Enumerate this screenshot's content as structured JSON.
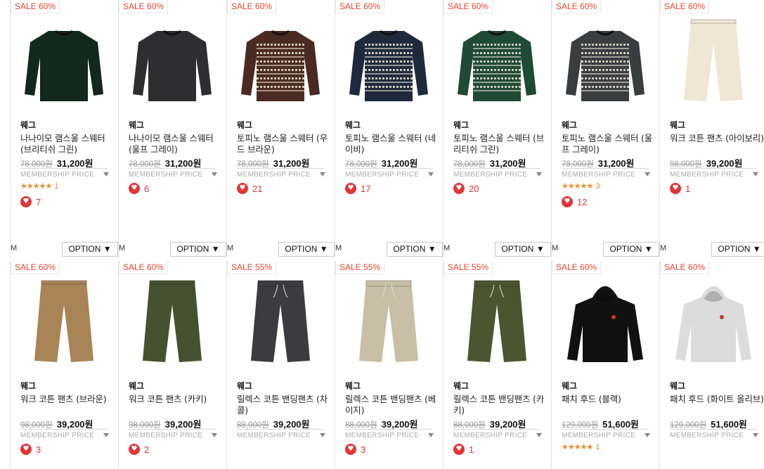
{
  "row1": [
    {
      "badge": "SALE 60%",
      "brand": "웨그",
      "name": "나나이모 램스울 스웨터 (브리티쉬 그린)",
      "orig_price": "78,000원",
      "sale_price": "31,200원",
      "membership": "MEMBERSHIP PRICE",
      "stars": "★★★★★",
      "rating_count": "1",
      "likes": "7",
      "size": "M",
      "option": "OPTION ▼",
      "image": "sweater-dark-green-icon",
      "color": "#12281c"
    },
    {
      "badge": "SALE 60%",
      "brand": "웨그",
      "name": "나나이모 램스울 스웨터 (울프 그레이)",
      "orig_price": "78,000원",
      "sale_price": "31,200원",
      "membership": "MEMBERSHIP PRICE",
      "likes": "6",
      "size": "M",
      "option": "OPTION ▼",
      "image": "sweater-charcoal-icon",
      "color": "#2e2e30"
    },
    {
      "badge": "SALE 60%",
      "brand": "웨그",
      "name": "토피노 램스울 스웨터 (우드 브라운)",
      "orig_price": "78,000원",
      "sale_price": "31,200원",
      "membership": "MEMBERSHIP PRICE",
      "likes": "21",
      "size": "M",
      "option": "OPTION ▼",
      "image": "fairisle-sweater-brown-icon",
      "color": "#4a2a22"
    },
    {
      "badge": "SALE 60%",
      "brand": "웨그",
      "name": "토피노 램스울 스웨터 (네이비)",
      "orig_price": "78,000원",
      "sale_price": "31,200원",
      "membership": "MEMBERSHIP PRICE",
      "likes": "17",
      "size": "M",
      "option": "OPTION ▼",
      "image": "fairisle-sweater-navy-icon",
      "color": "#1e2a3c"
    },
    {
      "badge": "SALE 60%",
      "brand": "웨그",
      "name": "토피노 램스울 스웨터 (브리티쉬 그린)",
      "orig_price": "78,000원",
      "sale_price": "31,200원",
      "membership": "MEMBERSHIP PRICE",
      "likes": "20",
      "size": "M",
      "option": "OPTION ▼",
      "image": "fairisle-sweater-green-icon",
      "color": "#1f4a35"
    },
    {
      "badge": "SALE 60%",
      "brand": "웨그",
      "name": "토피노 램스울 스웨터 (울프 그레이)",
      "orig_price": "78,000원",
      "sale_price": "31,200원",
      "membership": "MEMBERSHIP PRICE",
      "stars": "★★★★★",
      "rating_count": "3",
      "likes": "12",
      "size": "M",
      "option": "OPTION ▼",
      "image": "fairisle-sweater-grey-icon",
      "color": "#3a3d40"
    },
    {
      "badge": "SALE 60%",
      "brand": "웨그",
      "name": "워크 코튼 팬츠 (아이보리)",
      "orig_price": "98,000원",
      "sale_price": "39,200원",
      "membership": "MEMBERSHIP PRICE",
      "likes": "1",
      "size": "M",
      "option": "OPTION ▼",
      "image": "pants-ivory-icon",
      "color": "#efe6d4"
    }
  ],
  "row2": [
    {
      "badge": "SALE 60%",
      "brand": "웨그",
      "name": "워크 코튼 팬츠 (브라운)",
      "orig_price": "98,000원",
      "sale_price": "39,200원",
      "membership": "MEMBERSHIP PRICE",
      "likes": "3",
      "image": "pants-brown-icon",
      "color": "#a98457"
    },
    {
      "badge": "SALE 60%",
      "brand": "웨그",
      "name": "워크 코튼 팬츠 (카키)",
      "orig_price": "98,000원",
      "sale_price": "39,200원",
      "membership": "MEMBERSHIP PRICE",
      "likes": "2",
      "image": "pants-khaki-icon",
      "color": "#46512f"
    },
    {
      "badge": "SALE 55%",
      "brand": "웨그",
      "name": "릴렉스 코튼 밴딩팬츠 (차콜)",
      "orig_price": "88,000원",
      "sale_price": "39,200원",
      "membership": "MEMBERSHIP PRICE",
      "image": "banding-pants-charcoal-icon",
      "color": "#3c3c3e"
    },
    {
      "badge": "SALE 55%",
      "brand": "웨그",
      "name": "릴렉스 코튼 밴딩팬츠 (베이지)",
      "orig_price": "88,000원",
      "sale_price": "39,200원",
      "membership": "MEMBERSHIP PRICE",
      "likes": "3",
      "image": "banding-pants-beige-icon",
      "color": "#c9bfa6"
    },
    {
      "badge": "SALE 55%",
      "brand": "웨그",
      "name": "릴렉스 코튼 밴딩팬츠 (카키)",
      "orig_price": "88,000원",
      "sale_price": "39,200원",
      "membership": "MEMBERSHIP PRICE",
      "likes": "1",
      "image": "banding-pants-khaki-icon",
      "color": "#4b5530"
    },
    {
      "badge": "SALE 60%",
      "brand": "웨그",
      "name": "패치 후드 (블랙)",
      "orig_price": "129,000원",
      "sale_price": "51,600원",
      "membership": "MEMBERSHIP PRICE",
      "stars": "★★★★★",
      "rating_count": "1",
      "image": "hoodie-black-icon",
      "color": "#111111"
    },
    {
      "badge": "SALE 60%",
      "brand": "웨그",
      "name": "패치 후드 (화이트 올리브)",
      "orig_price": "129,000원",
      "sale_price": "51,600원",
      "membership": "MEMBERSHIP PRICE",
      "image": "hoodie-white-icon",
      "color": "#dcdcdc"
    }
  ],
  "colors": {
    "accent": "#e8452f",
    "heart": "#e23636",
    "star": "#f08a28"
  }
}
